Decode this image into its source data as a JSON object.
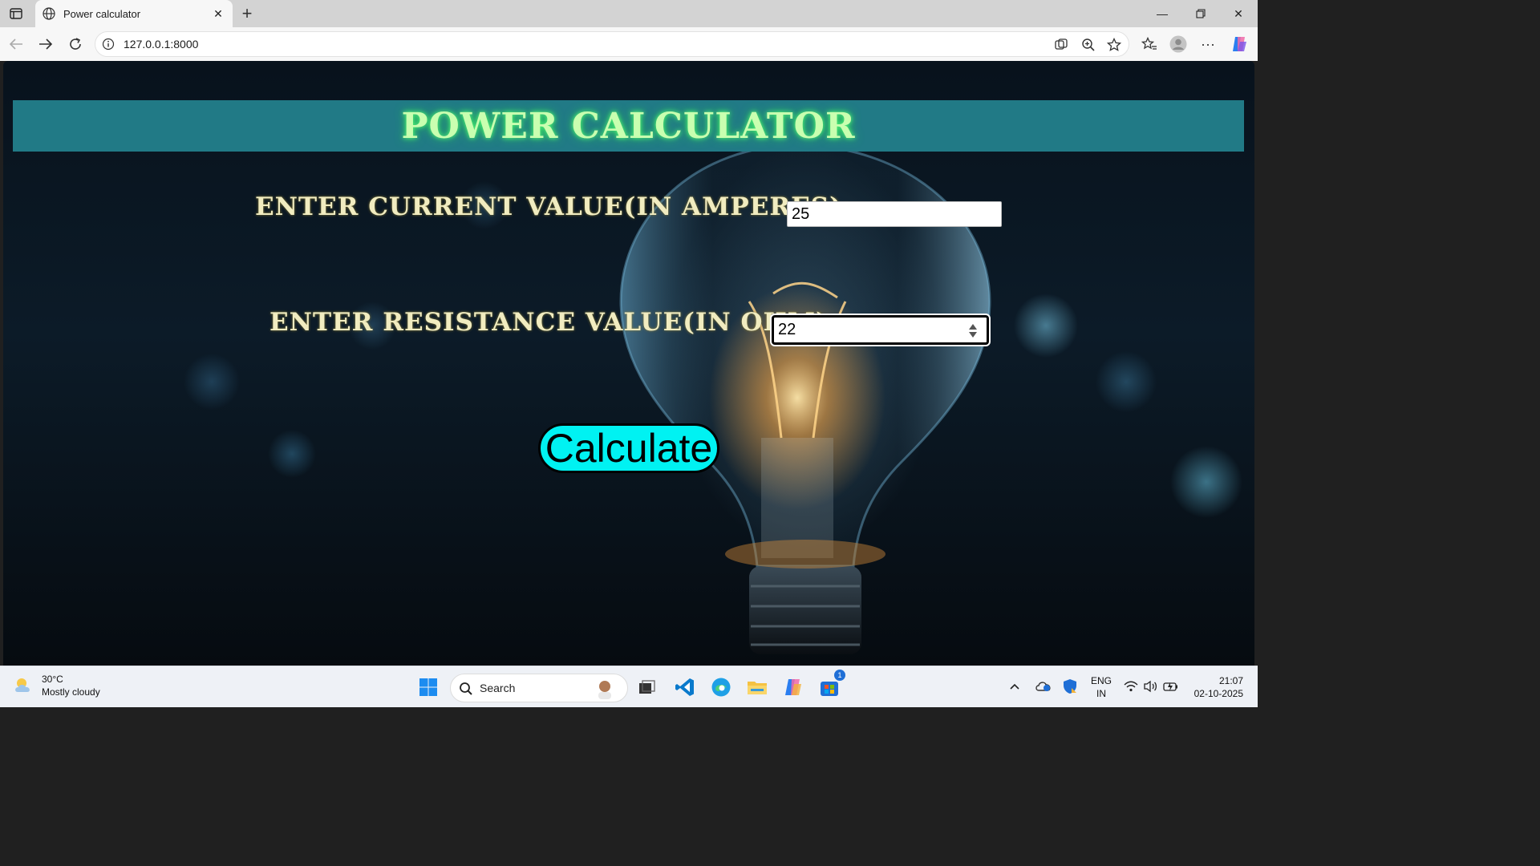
{
  "browser": {
    "tab_title": "Power calculator",
    "url": "127.0.0.1:8000"
  },
  "page": {
    "heading": "POWER CALCULATOR",
    "current_label": "ENTER CURRENT VALUE(IN AMPERES):",
    "current_value": "25",
    "resistance_label": "ENTER RESISTANCE VALUE(IN OHM):",
    "resistance_value": "22",
    "calculate_label": "Calculate"
  },
  "colors": {
    "banner": "#217a86",
    "heading_glow": "#56ff7c",
    "button": "#00f2f2"
  },
  "taskbar": {
    "weather_temp": "30°C",
    "weather_desc": "Mostly cloudy",
    "search_label": "Search",
    "lang": "ENG",
    "region": "IN",
    "time": "21:07",
    "date": "02-10-2025",
    "store_badge": "1"
  }
}
